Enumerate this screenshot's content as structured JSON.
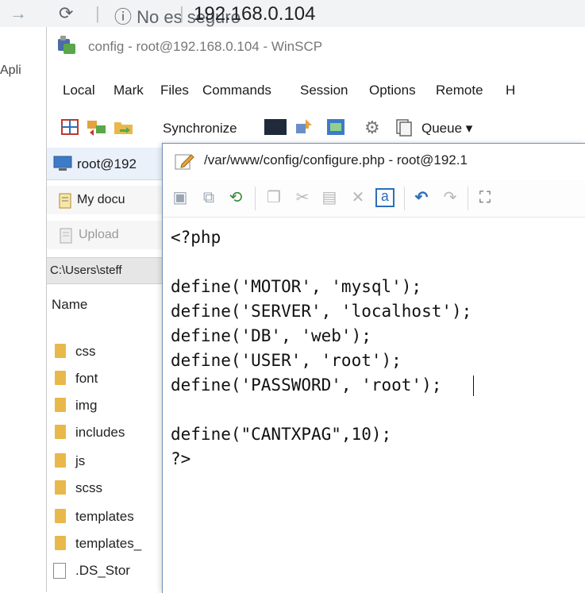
{
  "browser": {
    "back_glyph": "→",
    "reload_glyph": "C",
    "info_text": "ⓘ No es seguro",
    "separator": "|",
    "url": "192.168.0.104",
    "apps_label": "Apli"
  },
  "winscp": {
    "title": "config - root@192.168.0.104 - WinSCP",
    "menu": [
      "Local",
      "Mark",
      "Files",
      "Commands",
      "Session",
      "Options",
      "Remote",
      "H"
    ],
    "toolbar": {
      "synchronize_label": "Synchronize",
      "queue_label": "Queue ▾"
    },
    "session_tab_label": "root@192",
    "local_path_label": "My docu",
    "upload_label": "Upload",
    "local_dir": "C:\\Users\\steff",
    "name_header": "Name",
    "files": [
      {
        "name": "css",
        "type": "folder"
      },
      {
        "name": "font",
        "type": "folder"
      },
      {
        "name": "img",
        "type": "folder"
      },
      {
        "name": "includes",
        "type": "folder"
      },
      {
        "name": "js",
        "type": "folder"
      },
      {
        "name": "scss",
        "type": "folder"
      },
      {
        "name": "templates",
        "type": "folder"
      },
      {
        "name": "templates_",
        "type": "folder"
      },
      {
        "name": ".DS_Stor",
        "type": "file"
      }
    ]
  },
  "editor": {
    "title": "/var/www/config/configure.php - root@192.1",
    "code_lines": [
      "<?php",
      "",
      "define('MOTOR', 'mysql');",
      "define('SERVER', 'localhost');",
      "define('DB', 'web');",
      "define('USER', 'root');",
      "define('PASSWORD', 'root');",
      "",
      "define(\"CANTXPAG\",10);",
      "?>"
    ]
  },
  "colors": {
    "accent": "#6f8eb8",
    "folder": "#e8b84a",
    "session_tab": "#eaf1fb"
  },
  "icons": [
    "back-arrow-icon",
    "reload-icon",
    "info-icon",
    "winscp-app-icon",
    "new-panel-icon",
    "synchronize-icon",
    "sync-browse-icon",
    "console-icon",
    "putty-icon",
    "compare-icon",
    "preferences-gear-icon",
    "queue-icon",
    "computer-icon",
    "documents-icon",
    "upload-icon",
    "folder-icon",
    "file-icon",
    "edit-pencil-icon",
    "save-icon",
    "save-all-icon",
    "reload-file-icon",
    "copy-icon",
    "cut-icon",
    "paste-icon",
    "delete-icon",
    "select-all-icon",
    "undo-icon",
    "redo-icon",
    "find-binoculars-icon"
  ]
}
